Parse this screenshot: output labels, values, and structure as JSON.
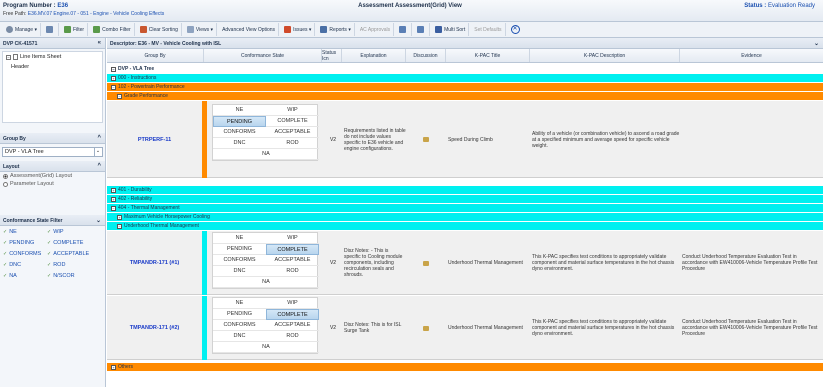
{
  "header": {
    "program_label": "Program Number :",
    "program_value": "E36",
    "free_path_label": "Free Path:",
    "free_path_value": "E36.MV.07 Engine.07 - 051 - Engine - Vehicle Cooling Effects",
    "title": "Assessment Assessment(Grid) View",
    "status_label": "Status :",
    "status_value": "Evaluation Ready"
  },
  "toolbar": {
    "manage": "Manage ▾",
    "filter": "Filter",
    "combo_filter": "Combo Filter",
    "clear_sorting": "Clear Sorting",
    "views": "Views ▾",
    "advanced_view_options": "Advanced View Options",
    "issues": "Issues ▾",
    "reports": "Reports ▾",
    "ac_approvals": "AC Approvals",
    "multi_sort": "Multi Sort",
    "set_defaults": "Set Defaults"
  },
  "left": {
    "dvp_title": "DVP CK-41571",
    "collapse_glyph": "«",
    "tree_root": "Line Items Sheet",
    "tree_child": "Header",
    "group_by_title": "Group By",
    "group_by_value": "DVP - VLA Tree",
    "layout_title": "Layout",
    "layout_options": [
      "Assessment(Grid) Layout",
      "Parameter Layout"
    ],
    "csf_title": "Conformance State Filter",
    "csf_items": [
      "NE",
      "WIP",
      "PENDING",
      "COMPLETE",
      "CONFORMS",
      "ACCEPTABLE",
      "DNC",
      "ROD",
      "NA",
      "N/SCOR"
    ]
  },
  "main": {
    "descriptor": "Descriptor: E36 - MV - Vehicle Cooling with ISL",
    "columns": [
      "Group By",
      "Conformance State",
      "Status Icn",
      "Explanation",
      "Discussion",
      "K-PAC Title",
      "K-PAC Description",
      "Evidence"
    ],
    "groups": {
      "root": "DVP - VLA Tree",
      "g000": "000 - Instructions",
      "g102": "102 - Powertrain Performance",
      "g_grade": "Grade Performance",
      "g401": "401 - Durability",
      "g402": "402 - Reliability",
      "g404": "404 - Thermal Management",
      "g_max": "Maximum Vehicle Horsepower Cooling",
      "g_under": "Underhood Thermal Management",
      "others": "Others"
    },
    "state_labels": [
      "NE",
      "WIP",
      "PENDING",
      "COMPLETE",
      "CONFORMS",
      "ACCEPTABLE",
      "DNC",
      "ROD",
      "NA"
    ],
    "rows": [
      {
        "id": "PTRPERF-11",
        "selected_state": "PENDING",
        "status": "V2",
        "explanation": "Requirements listed in table do not include values specific to E36 vehicle and engine configurations.",
        "kpac_title": "Speed During Climb",
        "kpac_desc": "Ability of a vehicle (or combination vehicle) to ascend a road grade at a specified minimum and average speed for specific vehicle weight.",
        "evidence": ""
      },
      {
        "id": "TMPANDR-171 (#1)",
        "selected_state": "COMPLETE",
        "status": "V2",
        "explanation": "Disz Notes: - This is specific to Cooling module components, including recirculation seals and shrouds.",
        "kpac_title": "Underhood Thermal Management",
        "kpac_desc": "This K-PAC specifies test conditions to appropriately validate component and material surface temperatures in the hot chassis dyno environment.",
        "evidence": "Conduct Underhood Temperature Evaluation Test in accordance with EW410006-Vehicle Temperature Profile Test Procedure"
      },
      {
        "id": "TMPANDR-171 (#2)",
        "selected_state": "COMPLETE",
        "status": "V2",
        "explanation": "Disz Notes: This is for ISL Surge Tank",
        "kpac_title": "Underhood Thermal Management",
        "kpac_desc": "This K-PAC specifies test conditions to appropriately validate component and material surface temperatures in the hot chassis dyno environment.",
        "evidence": "Conduct Underhood Temperature Evaluation Test in accordance with EW410006-Vehicle Temperature Profile Test Procedure"
      }
    ]
  },
  "colors": {
    "cyan_group": "#00f0f0",
    "orange_group": "#ff8a00",
    "selected_state": "#c2dbf2",
    "id_link": "#1a3bc8"
  }
}
